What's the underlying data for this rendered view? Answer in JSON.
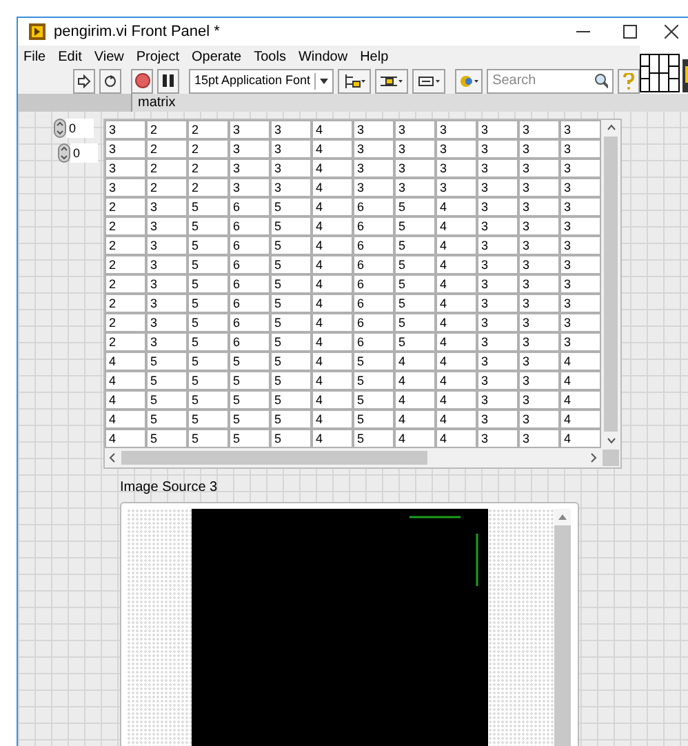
{
  "window": {
    "title": "pengirim.vi Front Panel *"
  },
  "menu": [
    "File",
    "Edit",
    "View",
    "Project",
    "Operate",
    "Tools",
    "Window",
    "Help"
  ],
  "toolbar": {
    "font": "15pt Application Font",
    "search": {
      "placeholder": "Search"
    }
  },
  "matrix": {
    "label": "matrix",
    "indices": [
      "0",
      "0"
    ],
    "rows": [
      [
        "3",
        "2",
        "2",
        "3",
        "3",
        "4",
        "3",
        "3",
        "3",
        "3",
        "3",
        "3"
      ],
      [
        "3",
        "2",
        "2",
        "3",
        "3",
        "4",
        "3",
        "3",
        "3",
        "3",
        "3",
        "3"
      ],
      [
        "3",
        "2",
        "2",
        "3",
        "3",
        "4",
        "3",
        "3",
        "3",
        "3",
        "3",
        "3"
      ],
      [
        "3",
        "2",
        "2",
        "3",
        "3",
        "4",
        "3",
        "3",
        "3",
        "3",
        "3",
        "3"
      ],
      [
        "2",
        "3",
        "5",
        "6",
        "5",
        "4",
        "6",
        "5",
        "4",
        "3",
        "3",
        "3"
      ],
      [
        "2",
        "3",
        "5",
        "6",
        "5",
        "4",
        "6",
        "5",
        "4",
        "3",
        "3",
        "3"
      ],
      [
        "2",
        "3",
        "5",
        "6",
        "5",
        "4",
        "6",
        "5",
        "4",
        "3",
        "3",
        "3"
      ],
      [
        "2",
        "3",
        "5",
        "6",
        "5",
        "4",
        "6",
        "5",
        "4",
        "3",
        "3",
        "3"
      ],
      [
        "2",
        "3",
        "5",
        "6",
        "5",
        "4",
        "6",
        "5",
        "4",
        "3",
        "3",
        "3"
      ],
      [
        "2",
        "3",
        "5",
        "6",
        "5",
        "4",
        "6",
        "5",
        "4",
        "3",
        "3",
        "3"
      ],
      [
        "2",
        "3",
        "5",
        "6",
        "5",
        "4",
        "6",
        "5",
        "4",
        "3",
        "3",
        "3"
      ],
      [
        "2",
        "3",
        "5",
        "6",
        "5",
        "4",
        "6",
        "5",
        "4",
        "3",
        "3",
        "3"
      ],
      [
        "4",
        "5",
        "5",
        "5",
        "5",
        "4",
        "5",
        "4",
        "4",
        "3",
        "3",
        "4"
      ],
      [
        "4",
        "5",
        "5",
        "5",
        "5",
        "4",
        "5",
        "4",
        "4",
        "3",
        "3",
        "4"
      ],
      [
        "4",
        "5",
        "5",
        "5",
        "5",
        "4",
        "5",
        "4",
        "4",
        "3",
        "3",
        "4"
      ],
      [
        "4",
        "5",
        "5",
        "5",
        "5",
        "4",
        "5",
        "4",
        "4",
        "3",
        "3",
        "4"
      ],
      [
        "4",
        "5",
        "5",
        "5",
        "5",
        "4",
        "5",
        "4",
        "4",
        "3",
        "3",
        "4"
      ]
    ]
  },
  "image_display": {
    "label": "Image Source 3"
  }
}
